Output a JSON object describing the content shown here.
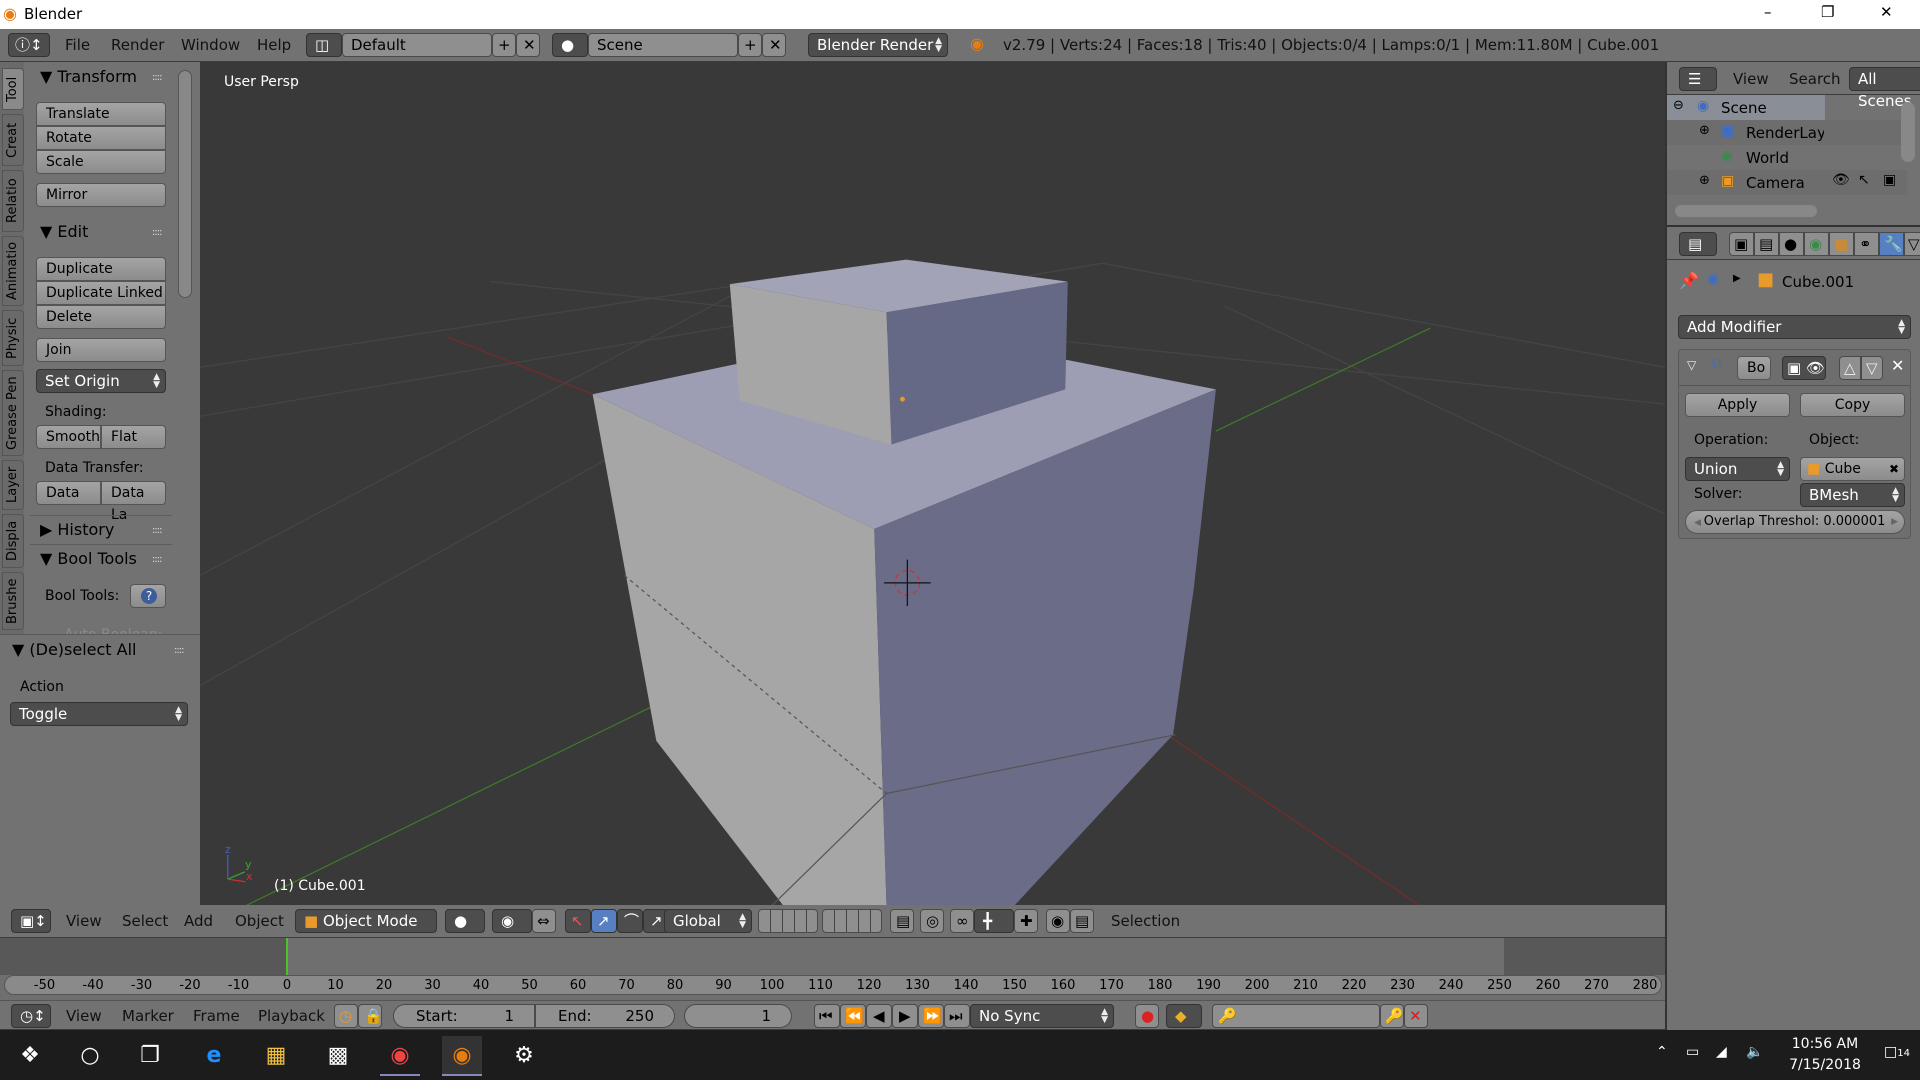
{
  "window": {
    "title": "Blender",
    "minimize": "–",
    "maximize": "❐",
    "close": "✕"
  },
  "info_header": {
    "menus": [
      "File",
      "Render",
      "Window",
      "Help"
    ],
    "layout": "Default",
    "scene": "Scene",
    "engine": "Blender Render",
    "stats": "v2.79 | Verts:24 | Faces:18 | Tris:40 | Objects:0/4 | Lamps:0/1 | Mem:11.80M | Cube.001"
  },
  "tool_shelf": {
    "tabs": [
      "Tool",
      "Creat",
      "Relatio",
      "Animatio",
      "Physic",
      "Grease Pen",
      "Layer",
      "Displa",
      "Brushe"
    ],
    "transform": {
      "title": "Transform",
      "buttons": [
        "Translate",
        "Rotate",
        "Scale"
      ],
      "mirror": "Mirror"
    },
    "edit": {
      "title": "Edit",
      "buttons": [
        "Duplicate",
        "Duplicate Linked",
        "Delete"
      ],
      "join": "Join",
      "set_origin": "Set Origin",
      "shading_label": "Shading:",
      "smooth": "Smooth",
      "flat": "Flat",
      "data_transfer_label": "Data Transfer:",
      "data": "Data",
      "data_layers": "Data La"
    },
    "history": {
      "title": "History"
    },
    "bool_tools": {
      "title": "Bool Tools",
      "label": "Bool Tools:",
      "help": "?",
      "auto_boolean": "Auto Boolean:"
    }
  },
  "redo_panel": {
    "title": "(De)select All",
    "action_label": "Action",
    "action_value": "Toggle"
  },
  "viewport": {
    "view_name": "User Persp",
    "object_info": "(1) Cube.001",
    "axes": {
      "x": "x",
      "y": "y",
      "z": "z"
    },
    "colors": {
      "background": "#393939",
      "face_light": "#a4a4a6",
      "face_dark": "#6a6c88",
      "x_axis": "#8a2a2a",
      "y_axis": "#3f7a2a"
    }
  },
  "view3d_header": {
    "menus": [
      "View",
      "Select",
      "Add",
      "Object"
    ],
    "mode": "Object Mode",
    "orientation": "Global",
    "selection_label": "Selection"
  },
  "timeline": {
    "ruler_ticks": [
      -50,
      -40,
      -30,
      -20,
      -10,
      0,
      10,
      20,
      30,
      40,
      50,
      60,
      70,
      80,
      90,
      100,
      110,
      120,
      130,
      140,
      150,
      160,
      170,
      180,
      190,
      200,
      210,
      220,
      230,
      240,
      250,
      260,
      270,
      280
    ],
    "current_frame_marker": 0,
    "menus": [
      "View",
      "Marker",
      "Frame",
      "Playback"
    ],
    "start_label": "Start:",
    "start": "1",
    "end_label": "End:",
    "end": "250",
    "current_frame": "1",
    "sync": "No Sync",
    "playhead_color": "#4cc32a"
  },
  "outliner": {
    "menus": [
      "View",
      "Search"
    ],
    "filter": "All Scenes",
    "items": [
      {
        "label": "Scene",
        "icon": "scene-icon"
      },
      {
        "label": "RenderLayer",
        "icon": "render-layer-icon"
      },
      {
        "label": "World",
        "icon": "world-icon"
      },
      {
        "label": "Camera",
        "icon": "camera-icon"
      }
    ]
  },
  "properties": {
    "object_name": "Cube.001",
    "add_modifier": "Add Modifier",
    "modifier": {
      "name": "Bo",
      "apply": "Apply",
      "copy": "Copy",
      "operation_label": "Operation:",
      "operation": "Union",
      "object_label": "Object:",
      "object": "Cube",
      "solver_label": "Solver:",
      "solver": "BMesh",
      "overlap": "Overlap Threshol:  0.000001"
    },
    "active_tab": "modifiers",
    "accent": "#5680c2"
  },
  "taskbar": {
    "time": "10:56 AM",
    "date": "7/15/2018",
    "notifications": "14",
    "apps": [
      "start-icon",
      "search-icon",
      "task-view-icon",
      "edge-icon",
      "file-explorer-icon",
      "store-icon",
      "chrome-icon",
      "blender-icon",
      "app-icon"
    ]
  }
}
